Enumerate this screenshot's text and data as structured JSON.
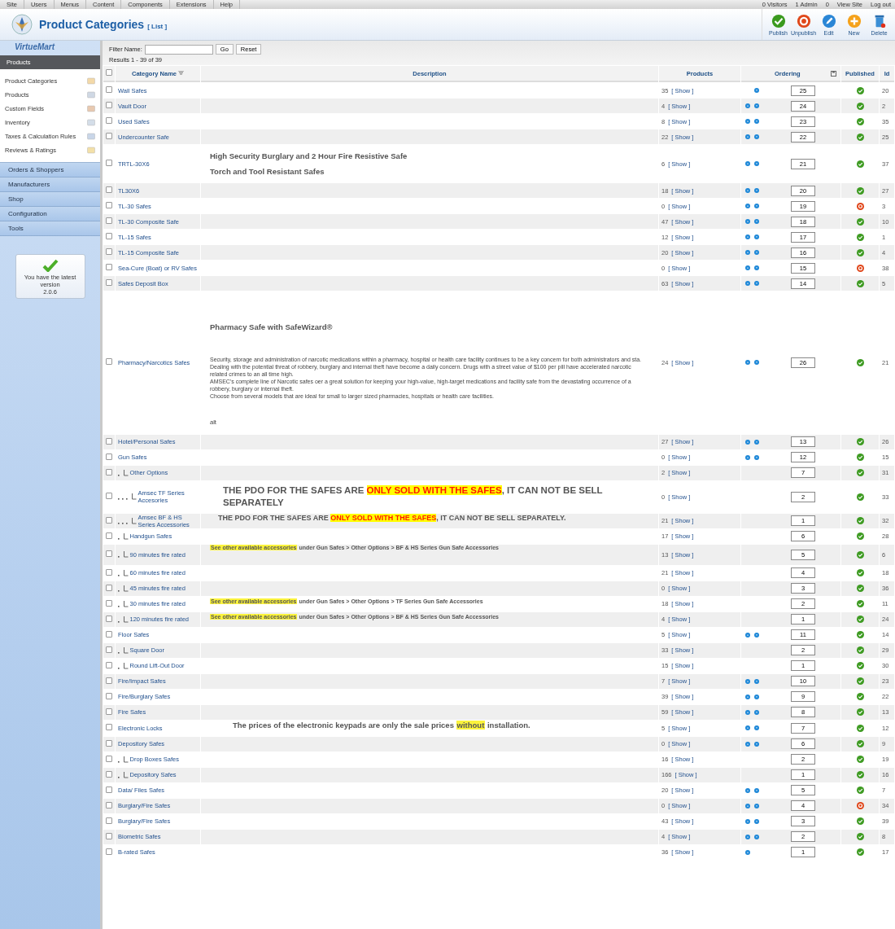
{
  "top_menu": {
    "items": [
      "Site",
      "Users",
      "Menus",
      "Content",
      "Components",
      "Extensions",
      "Help"
    ],
    "status": [
      "0 Visitors",
      "1 Admin",
      "0",
      "View Site",
      "Log out"
    ]
  },
  "header": {
    "title": "Product Categories",
    "subtitle": "[ List ]",
    "toolbar": [
      {
        "label": "Publish",
        "kind": "publish"
      },
      {
        "label": "Unpublish",
        "kind": "unpublish"
      },
      {
        "label": "Edit",
        "kind": "edit"
      },
      {
        "label": "New",
        "kind": "new"
      },
      {
        "label": "Delete",
        "kind": "delete"
      }
    ]
  },
  "sidebar": {
    "logo": "VirtueMart",
    "section": "Products",
    "items": [
      "Product Categories",
      "Products",
      "Custom Fields",
      "Inventory",
      "Taxes & Calculation Rules",
      "Reviews & Ratings"
    ],
    "groups": [
      "Orders & Shoppers",
      "Manufacturers",
      "Shop",
      "Configuration",
      "Tools"
    ],
    "version_note": "You have the latest version",
    "version": "2.0.6"
  },
  "filter": {
    "label": "Filter Name:",
    "go": "Go",
    "reset": "Reset",
    "results": "Results 1 - 39 of 39"
  },
  "table": {
    "select_all_checked": false,
    "columns": [
      "Category Name",
      "Description",
      "Products",
      "Ordering",
      "Published",
      "Id"
    ],
    "rows": [
      {
        "checked": false,
        "name": "Wall Safes",
        "count": "35",
        "show": "[ Show ]",
        "up": false,
        "down": true,
        "order": "25",
        "published": true,
        "id": "20"
      },
      {
        "checked": false,
        "name": "Vault Door",
        "count": "4",
        "show": "[ Show ]",
        "up": true,
        "down": true,
        "order": "24",
        "published": true,
        "id": "2"
      },
      {
        "checked": false,
        "name": "Used Safes",
        "count": "8",
        "show": "[ Show ]",
        "up": true,
        "down": true,
        "order": "23",
        "published": true,
        "id": "35"
      },
      {
        "checked": false,
        "name": "Undercounter Safe",
        "count": "22",
        "show": "[ Show ]",
        "up": true,
        "down": true,
        "order": "22",
        "published": true,
        "id": "25"
      },
      {
        "checked": false,
        "name": "TRTL-30X6",
        "count": "6",
        "show": "[ Show ]",
        "up": true,
        "down": true,
        "order": "21",
        "published": true,
        "id": "37",
        "description": [
          {
            "kind": "heading",
            "text": "High Security Burglary and 2 Hour Fire Resistive Safe"
          },
          {
            "kind": "heading",
            "text": "Torch and Tool Resistant Safes"
          }
        ]
      },
      {
        "checked": false,
        "name": "TL30X6",
        "count": "18",
        "show": "[ Show ]",
        "up": true,
        "down": true,
        "order": "20",
        "published": true,
        "id": "27"
      },
      {
        "checked": false,
        "name": "TL-30 Safes",
        "count": "0",
        "show": "[ Show ]",
        "up": true,
        "down": true,
        "order": "19",
        "published": false,
        "id": "3"
      },
      {
        "checked": false,
        "name": "TL-30 Composite Safe",
        "count": "47",
        "show": "[ Show ]",
        "up": true,
        "down": true,
        "order": "18",
        "published": true,
        "id": "10"
      },
      {
        "checked": false,
        "name": "TL-15 Safes",
        "count": "12",
        "show": "[ Show ]",
        "up": true,
        "down": true,
        "order": "17",
        "published": true,
        "id": "1"
      },
      {
        "checked": false,
        "name": "TL-15 Composite Safe",
        "count": "20",
        "show": "[ Show ]",
        "up": true,
        "down": true,
        "order": "16",
        "published": true,
        "id": "4"
      },
      {
        "checked": false,
        "name": "Sea-Cure (Boat) or RV Safes",
        "count": "0",
        "show": "[ Show ]",
        "up": true,
        "down": true,
        "order": "15",
        "published": false,
        "id": "38"
      },
      {
        "checked": false,
        "name": "Safes Deposit Box",
        "count": "63",
        "show": "[ Show ]",
        "up": true,
        "down": true,
        "order": "14",
        "published": true,
        "id": "5"
      },
      {
        "checked": false,
        "name": "Pharmacy/Narcotics Safes",
        "count": "24",
        "show": "[ Show ]",
        "up": true,
        "down": true,
        "order": "26",
        "published": true,
        "id": "21",
        "description": [
          {
            "kind": "title",
            "text": "Pharmacy Safe with SafeWizard®"
          },
          {
            "kind": "body",
            "text": "Security, storage and administration of narcotic medications within a pharmacy, hospital or health care facility continues to be a key concern for both administrators and sta."
          },
          {
            "kind": "body",
            "text": "Dealing with the potential threat of robbery, burglary and internal theft have become a daily concern. Drugs with a street value of $100 per pill have accelerated narcotic related crimes to an all time high."
          },
          {
            "kind": "body",
            "text": "AMSEC's complete line of Narcotic safes oer a great solution for keeping your high-value, high-target medications and facility safe from the devastating occurrence of a robbery, burglary or internal theft."
          },
          {
            "kind": "body",
            "text": "Choose from several models that are ideal for small to larger sized pharmacies, hospitals or health care facilities."
          },
          {
            "kind": "caption",
            "text": "alt"
          }
        ]
      },
      {
        "checked": false,
        "name": "Hotel/Personal Safes",
        "count": "27",
        "show": "[ Show ]",
        "up": true,
        "down": true,
        "order": "13",
        "published": true,
        "id": "26"
      },
      {
        "checked": false,
        "name": "Gun Safes",
        "count": "0",
        "show": "[ Show ]",
        "up": true,
        "down": true,
        "order": "12",
        "published": true,
        "id": "15",
        "children": [
          {
            "checked": false,
            "name": "Other Options",
            "count": "2",
            "show": "[ Show ]",
            "up": false,
            "down": false,
            "order": "7",
            "published": true,
            "id": "31",
            "children": [
              {
                "checked": false,
                "name": "Amsec TF Series Accesories",
                "count": "0",
                "show": "[ Show ]",
                "up": false,
                "down": false,
                "order": "2",
                "published": true,
                "id": "33",
                "description": [
                  {
                    "kind": "banner_large",
                    "parts": [
                      {
                        "text": "THE PDO FOR THE SAFES ARE ",
                        "kind": "plain"
                      },
                      {
                        "text": "ONLY SOLD WITH THE SAFES",
                        "kind": "alert"
                      },
                      {
                        "text": ", IT CAN NOT BE SELL SEPARATELY",
                        "kind": "plain"
                      }
                    ]
                  }
                ]
              },
              {
                "checked": false,
                "name": "Amsec BF & HS Series Accessories",
                "count": "21",
                "show": "[ Show ]",
                "up": false,
                "down": false,
                "order": "1",
                "published": true,
                "id": "32",
                "description": [
                  {
                    "kind": "banner",
                    "parts": [
                      {
                        "text": "THE PDO FOR THE SAFES ARE ",
                        "kind": "plain"
                      },
                      {
                        "text": "ONLY SOLD WITH THE SAFES",
                        "kind": "alert"
                      },
                      {
                        "text": ", IT CAN NOT BE SELL SEPARATELY.",
                        "kind": "plain"
                      }
                    ]
                  }
                ]
              }
            ]
          },
          {
            "checked": false,
            "name": "Handgun Safes",
            "count": "17",
            "show": "[ Show ]",
            "up": false,
            "down": false,
            "order": "6",
            "published": true,
            "id": "28"
          },
          {
            "checked": false,
            "name": "90 minutes fire rated",
            "count": "13",
            "show": "[ Show ]",
            "up": false,
            "down": false,
            "order": "5",
            "published": true,
            "id": "6",
            "description": [
              {
                "kind": "note_top",
                "parts": [
                  {
                    "text": "See other available accessories",
                    "kind": "marker"
                  },
                  {
                    "text": " under Gun Safes > Other Options > BF & HS Series Gun Safe Accessories",
                    "kind": "plain"
                  }
                ]
              }
            ]
          },
          {
            "checked": false,
            "name": "60 minutes fire rated",
            "count": "21",
            "show": "[ Show ]",
            "up": false,
            "down": false,
            "order": "4",
            "published": true,
            "id": "18"
          },
          {
            "checked": false,
            "name": "45 minutes fire rated",
            "count": "0",
            "show": "[ Show ]",
            "up": false,
            "down": false,
            "order": "3",
            "published": true,
            "id": "36"
          },
          {
            "checked": false,
            "name": "30 minutes fire rated",
            "count": "18",
            "show": "[ Show ]",
            "up": false,
            "down": false,
            "order": "2",
            "published": true,
            "id": "11",
            "description": [
              {
                "kind": "note",
                "parts": [
                  {
                    "text": "See other available accessories",
                    "kind": "marker"
                  },
                  {
                    "text": " under Gun Safes > Other Options > TF Series Gun Safe Accessories",
                    "kind": "plain"
                  }
                ]
              }
            ]
          },
          {
            "checked": false,
            "name": "120 minutes fire rated",
            "count": "4",
            "show": "[ Show ]",
            "up": false,
            "down": false,
            "order": "1",
            "published": true,
            "id": "24",
            "description": [
              {
                "kind": "note",
                "parts": [
                  {
                    "text": "See other available accessories",
                    "kind": "marker"
                  },
                  {
                    "text": " under Gun Safes > Other Options > BF & HS Series Gun Safe Accessories",
                    "kind": "plain"
                  }
                ]
              }
            ]
          }
        ]
      },
      {
        "checked": false,
        "name": "Floor Safes",
        "count": "5",
        "show": "[ Show ]",
        "up": true,
        "down": true,
        "order": "11",
        "published": true,
        "id": "14",
        "children": [
          {
            "checked": false,
            "name": "Square Door",
            "count": "33",
            "show": "[ Show ]",
            "up": false,
            "down": false,
            "order": "2",
            "published": true,
            "id": "29"
          },
          {
            "checked": false,
            "name": "Round Lift-Out Door",
            "count": "15",
            "show": "[ Show ]",
            "up": false,
            "down": false,
            "order": "1",
            "published": true,
            "id": "30"
          }
        ]
      },
      {
        "checked": false,
        "name": "Fire/Impact Safes",
        "count": "7",
        "show": "[ Show ]",
        "up": true,
        "down": true,
        "order": "10",
        "published": true,
        "id": "23"
      },
      {
        "checked": false,
        "name": "Fire/Burglary Safes",
        "count": "39",
        "show": "[ Show ]",
        "up": true,
        "down": true,
        "order": "9",
        "published": true,
        "id": "22"
      },
      {
        "checked": false,
        "name": "Fire Safes",
        "count": "59",
        "show": "[ Show ]",
        "up": true,
        "down": true,
        "order": "8",
        "published": true,
        "id": "13"
      },
      {
        "checked": false,
        "name": "Electronic Locks",
        "count": "5",
        "show": "[ Show ]",
        "up": true,
        "down": true,
        "order": "7",
        "published": true,
        "id": "12",
        "description": [
          {
            "kind": "statement",
            "parts": [
              {
                "text": "The prices of the electronic keypads are only the sale prices ",
                "kind": "plain"
              },
              {
                "text": "without",
                "kind": "marker"
              },
              {
                "text": " installation.",
                "kind": "plain"
              }
            ]
          }
        ]
      },
      {
        "checked": false,
        "name": "Depository Safes",
        "count": "0",
        "show": "[ Show ]",
        "up": true,
        "down": true,
        "order": "6",
        "published": true,
        "id": "9",
        "children": [
          {
            "checked": false,
            "name": "Drop Boxes Safes",
            "count": "16",
            "show": "[ Show ]",
            "up": false,
            "down": false,
            "order": "2",
            "published": true,
            "id": "19"
          },
          {
            "checked": false,
            "name": "Depository Safes",
            "count": "166",
            "show": "[ Show ]",
            "up": false,
            "down": false,
            "order": "1",
            "published": true,
            "id": "16"
          }
        ]
      },
      {
        "checked": false,
        "name": "Data/ Files Safes",
        "count": "20",
        "show": "[ Show ]",
        "up": true,
        "down": true,
        "order": "5",
        "published": true,
        "id": "7"
      },
      {
        "checked": false,
        "name": "Burglary/Fire Safes",
        "count": "0",
        "show": "[ Show ]",
        "up": true,
        "down": true,
        "order": "4",
        "published": false,
        "id": "34"
      },
      {
        "checked": false,
        "name": "Burglary/Fire Safes",
        "count": "43",
        "show": "[ Show ]",
        "up": true,
        "down": true,
        "order": "3",
        "published": true,
        "id": "39"
      },
      {
        "checked": false,
        "name": "Biometric Safes",
        "count": "4",
        "show": "[ Show ]",
        "up": true,
        "down": true,
        "order": "2",
        "published": true,
        "id": "8"
      },
      {
        "checked": false,
        "name": "B-rated Safes",
        "count": "36",
        "show": "[ Show ]",
        "up": true,
        "down": false,
        "order": "1",
        "published": true,
        "id": "17"
      }
    ]
  }
}
